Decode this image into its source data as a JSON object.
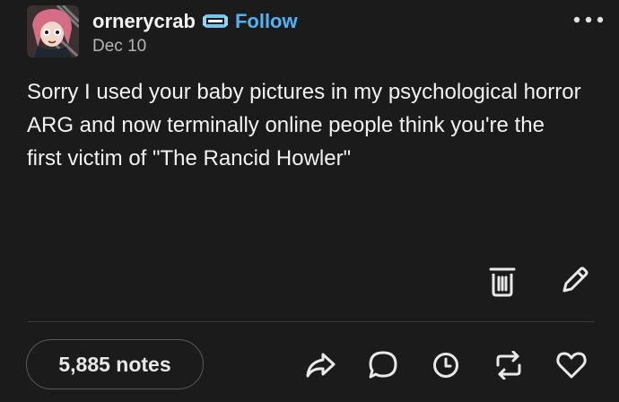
{
  "post": {
    "username": "ornerycrab",
    "follow_label": "Follow",
    "date": "Dec 10",
    "text": "Sorry I used your baby pictures in my psychological horror ARG and now terminally online people think you're the first victim of \"The Rancid Howler\"",
    "notes_count": "5,885 notes"
  },
  "colors": {
    "background": "#1b1b1b",
    "text": "#f2f2f2",
    "follow": "#4fb3f6",
    "secondary_text": "#b5b5b5",
    "icon": "#e9e9e9"
  },
  "icons": {
    "header_badge": "blog-badge-icon",
    "more": "more-options-icon",
    "owner_actions": [
      "trash-icon",
      "edit-pencil-icon"
    ],
    "footer_actions": [
      "share-icon",
      "reply-icon",
      "history-icon",
      "reblog-icon",
      "like-heart-icon"
    ]
  }
}
